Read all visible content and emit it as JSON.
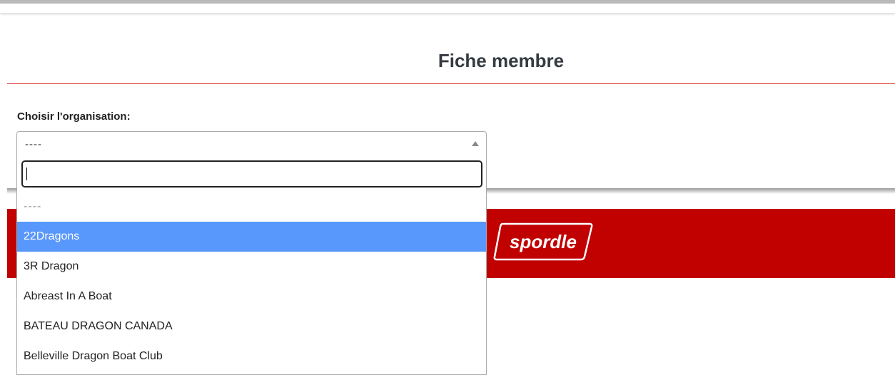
{
  "page": {
    "title": "Fiche membre"
  },
  "form": {
    "org_label": "Choisir l'organisation:",
    "selected_value": "----"
  },
  "dropdown": {
    "search_value": "",
    "options": [
      {
        "label": "----"
      },
      {
        "label": "22Dragons"
      },
      {
        "label": "3R Dragon"
      },
      {
        "label": "Abreast In A Boat"
      },
      {
        "label": "BATEAU DRAGON CANADA"
      },
      {
        "label": "Belleville Dragon Boat Club"
      }
    ],
    "highlighted_option": "22Dragons"
  },
  "brand": {
    "logo_text": "spordle",
    "band_color": "#c10000",
    "highlight_color": "#5897fb",
    "rule_color": "#dd3333"
  }
}
